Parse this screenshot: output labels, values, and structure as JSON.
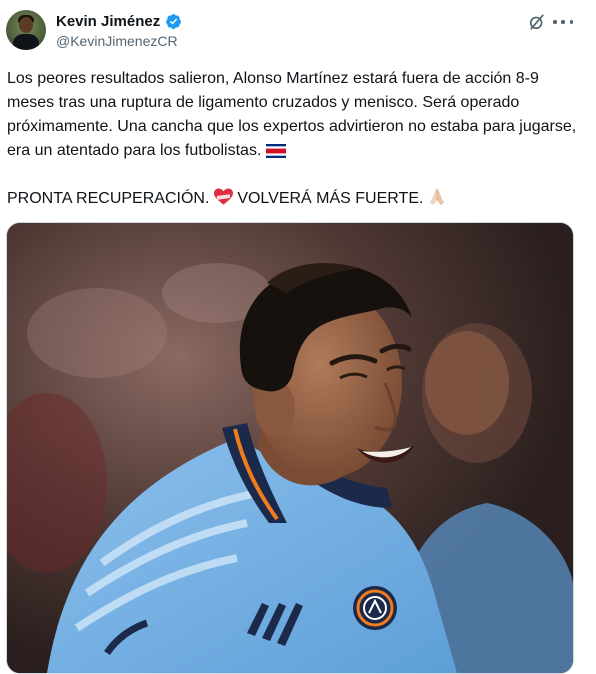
{
  "author": {
    "display_name": "Kevin Jiménez",
    "handle": "@KevinJimenezCR"
  },
  "tweet": {
    "paragraph_1": "Los peores resultados salieron, Alonso Martínez estará fuera de acción 8-9 meses tras una ruptura de ligamento cruzados y menisco. Será operado próximamente. Una cancha que los expertos advirtieron no estaba para jugarse, era un atentado para los futbolistas.",
    "paragraph_2_a": "PRONTA RECUPERACIÓN.",
    "paragraph_2_b": "VOLVERÁ MÁS FUERTE."
  },
  "icons": {
    "verified": "verified-badge-icon",
    "flag": "costa-rica-flag-icon",
    "heart": "mending-heart-icon",
    "pray": "folded-hands-icon",
    "grok": "grok-icon",
    "more": "more-options-icon"
  },
  "colors": {
    "verified_blue": "#1d9bf0",
    "text": "#0f1419",
    "secondary_text": "#536471",
    "jersey_blue": "#6cace4"
  }
}
